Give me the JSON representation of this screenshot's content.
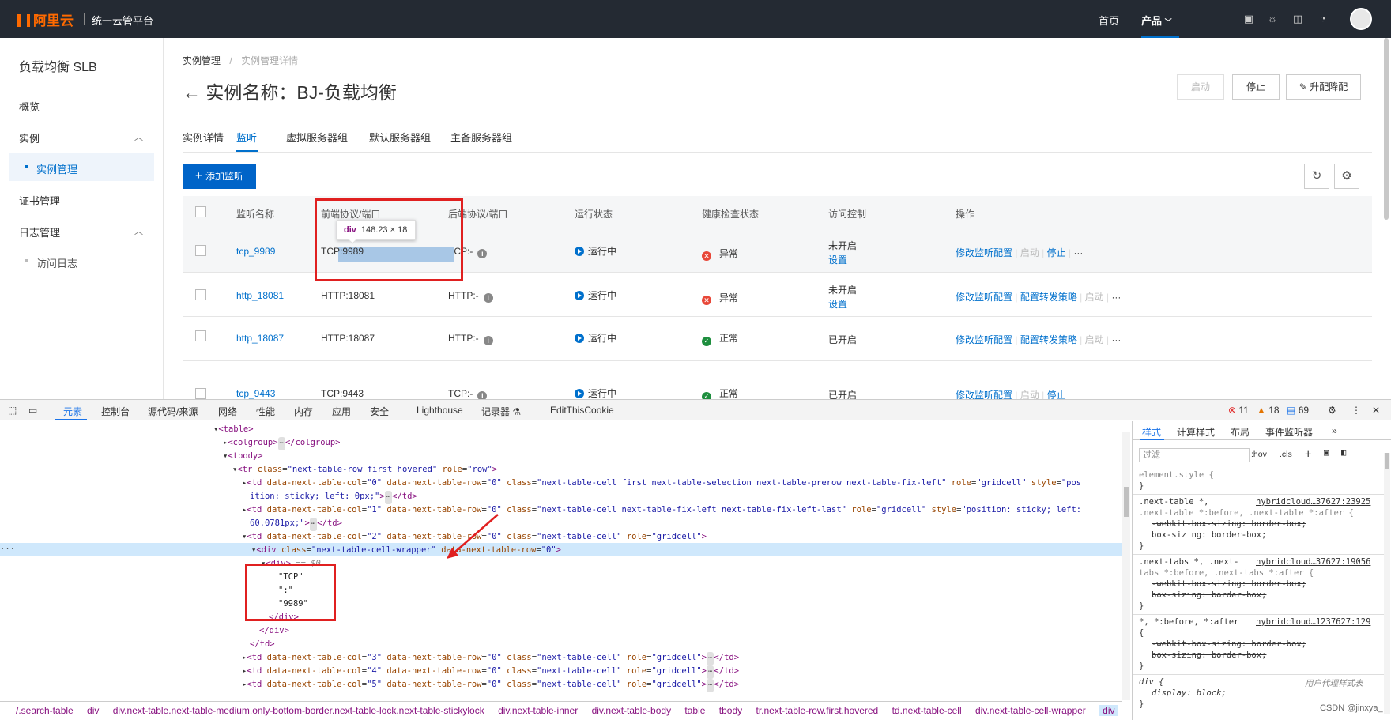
{
  "topbar": {
    "logo": "阿里云",
    "platform": "统一云管平台",
    "nav_home": "首页",
    "nav_products": "产品"
  },
  "sidebar": {
    "title": "负载均衡 SLB",
    "items": [
      {
        "label": "概览"
      },
      {
        "label": "实例"
      },
      {
        "label": "实例管理"
      },
      {
        "label": "证书管理"
      },
      {
        "label": "日志管理"
      },
      {
        "label": "访问日志"
      }
    ]
  },
  "breadcrumb": {
    "first": "实例管理",
    "sep": "/",
    "second": "实例管理详情"
  },
  "page": {
    "back": "←",
    "title": "实例名称：BJ-负载均衡",
    "btn_start": "启动",
    "btn_stop": "停止",
    "btn_upgrade": "升配降配"
  },
  "tabs": [
    "实例详情",
    "监听",
    "虚拟服务器组",
    "默认服务器组",
    "主备服务器组"
  ],
  "toolbar": {
    "add": "添加监听"
  },
  "table": {
    "columns": [
      "监听名称",
      "前端协议/端口",
      "后端协议/端口",
      "运行状态",
      "健康检查状态",
      "访问控制",
      "操作"
    ],
    "rows": [
      {
        "name": "tcp_9989",
        "front": "TCP:9989",
        "back": "TCP:-",
        "run": "运行中",
        "health": "异常",
        "acl": "未开启",
        "acl_link": "设置",
        "op1": "修改监听配置",
        "op2": "",
        "op3": "启动",
        "op4": "停止",
        "more": "···"
      },
      {
        "name": "http_18081",
        "front": "HTTP:18081",
        "back": "HTTP:-",
        "run": "运行中",
        "health": "异常",
        "acl": "未开启",
        "acl_link": "设置",
        "op1": "修改监听配置",
        "op2": "配置转发策略",
        "op3": "启动",
        "op4": "",
        "more": "···"
      },
      {
        "name": "http_18087",
        "front": "HTTP:18087",
        "back": "HTTP:-",
        "run": "运行中",
        "health": "正常",
        "acl": "已开启",
        "acl_link": "",
        "op1": "修改监听配置",
        "op2": "配置转发策略",
        "op3": "启动",
        "op4": "",
        "more": "···"
      },
      {
        "name": "tcp_9443",
        "front": "TCP:9443",
        "back": "TCP:-",
        "run": "运行中",
        "health": "正常",
        "acl": "已开启",
        "acl_link": "",
        "op1": "修改监听配置",
        "op2": "",
        "op3": "启动",
        "op4": "停止",
        "more": "···"
      }
    ]
  },
  "tooltip": {
    "tag": "div",
    "size": "148.23 × 18"
  },
  "devtools": {
    "tabs": [
      "元素",
      "控制台",
      "源代码/来源",
      "网络",
      "性能",
      "内存",
      "应用",
      "安全",
      "Lighthouse",
      "记录器 ⚗",
      "EditThisCookie"
    ],
    "errors": "11",
    "warnings": "18",
    "messages": "69",
    "styles_tabs": [
      "样式",
      "计算样式",
      "布局",
      "事件监听器",
      "»"
    ],
    "filter_placeholder": "过滤",
    "hov": ":hov",
    "cls": ".cls",
    "breadcrumbs": [
      "/.search-table",
      "div",
      "div.next-table.next-table-medium.only-bottom-border.next-table-lock.next-table-stickylock",
      "div.next-table-inner",
      "div.next-table-body",
      "table",
      "tbody",
      "tr.next-table-row.first.hovered",
      "td.next-table-cell",
      "div.next-table-cell-wrapper",
      "div"
    ],
    "element_style": "element.style {",
    "rule1_sel": ".next-table *,",
    "rule1_sel2": ".next-table *:before, .next-table *:after {",
    "rule1_src": "hybridcloud…37627:23925",
    "rule2_sel": ".next-tabs *, .next-",
    "rule2_sel2": "tabs *:before, .next-tabs *:after {",
    "rule2_src": "hybridcloud…37627:19056",
    "rule3_sel": "*, *:before, *:after",
    "rule3_src": "hybridcloud…1237627:129",
    "prop_webkit": "-webkit-box-sizing: border-box;",
    "prop_box": "box-sizing: border-box;",
    "rule4_sel": "div {",
    "rule4_src": "用户代理样式表",
    "prop_display": "display: block;",
    "watermark": "CSDN @jinxya_"
  }
}
